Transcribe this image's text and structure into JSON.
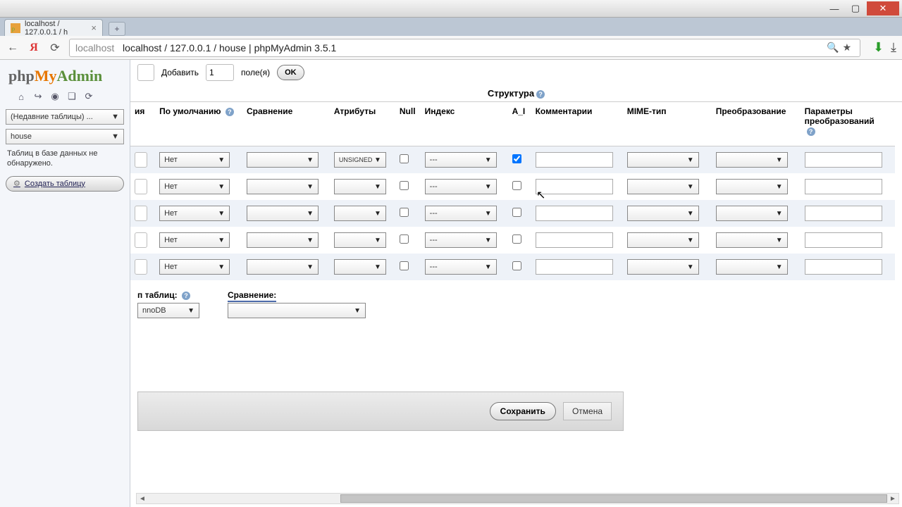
{
  "browser": {
    "tab_title": "localhost / 127.0.0.1 / h",
    "url_host": "localhost",
    "url_path": "localhost / 127.0.0.1 / house | phpMyAdmin 3.5.1"
  },
  "sidebar": {
    "logo": {
      "php": "php",
      "my": "My",
      "admin": "Admin"
    },
    "recent_select": "(Недавние таблицы) ...",
    "db_select": "house",
    "no_tables_text": "Таблиц в базе данных не обнаружено.",
    "create_table": "Создать таблицу"
  },
  "addfields": {
    "label_add": "Добавить",
    "count": "1",
    "label_fields": "поле(я)",
    "ok": "OK"
  },
  "structure_title": "Структура",
  "columns": {
    "name_cut": "ия",
    "default": "По умолчанию",
    "collation": "Сравнение",
    "attributes": "Атрибуты",
    "null": "Null",
    "index": "Индекс",
    "ai": "A_I",
    "comments": "Комментарии",
    "mime": "MIME-тип",
    "transformation": "Преобразование",
    "transformation_params": "Параметры преобразований"
  },
  "rows": [
    {
      "default": "Нет",
      "attr": "UNSIGNED",
      "index": "---",
      "ai": true,
      "comments": "",
      "mime": "",
      "trans": "",
      "tparams": ""
    },
    {
      "default": "Нет",
      "attr": "",
      "index": "---",
      "ai": false,
      "comments": "",
      "mime": "",
      "trans": "",
      "tparams": ""
    },
    {
      "default": "Нет",
      "attr": "",
      "index": "---",
      "ai": false,
      "comments": "",
      "mime": "",
      "trans": "",
      "tparams": ""
    },
    {
      "default": "Нет",
      "attr": "",
      "index": "---",
      "ai": false,
      "comments": "",
      "mime": "",
      "trans": "",
      "tparams": ""
    },
    {
      "default": "Нет",
      "attr": "",
      "index": "---",
      "ai": false,
      "comments": "",
      "mime": "",
      "trans": "",
      "tparams": ""
    }
  ],
  "options": {
    "table_type_label": "п таблиц:",
    "table_type_value": "nnoDB",
    "collation_label": "Сравнение:"
  },
  "footer": {
    "save": "Сохранить",
    "cancel": "Отмена"
  }
}
